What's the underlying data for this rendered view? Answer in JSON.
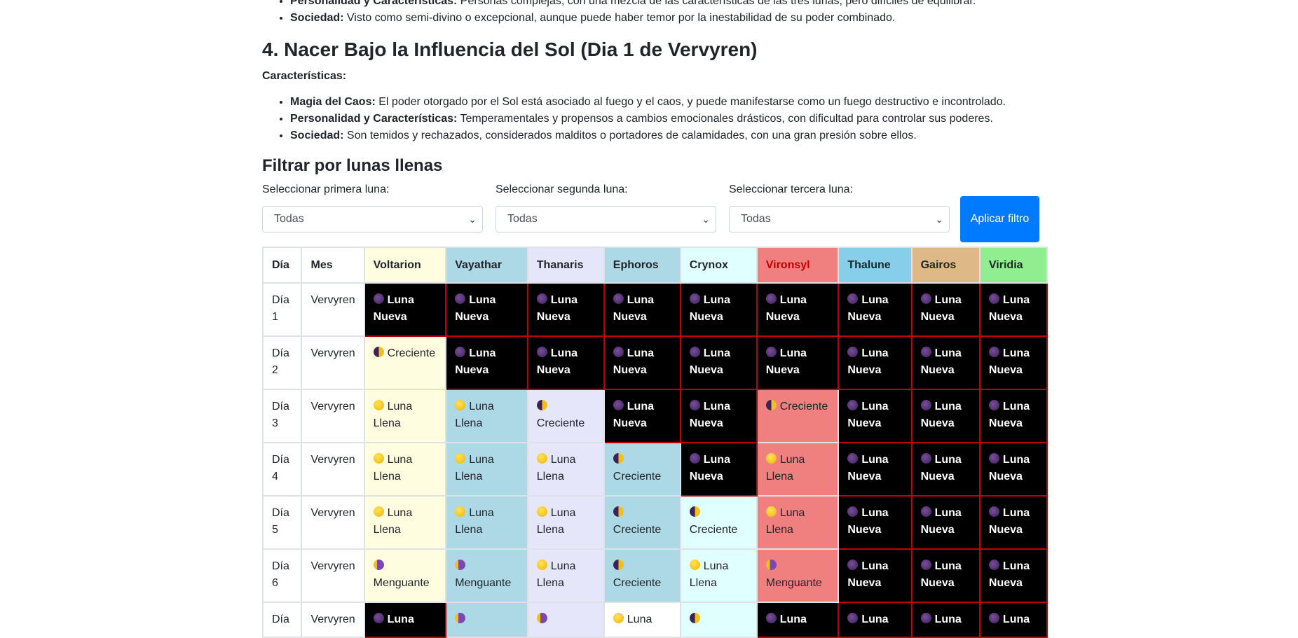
{
  "top_items": [
    {
      "label": "Personalidad y Características:",
      "text": " Personas complejas, con una mezcla de las características de las tres lunas, pero difíciles de equilibrar."
    },
    {
      "label": "Sociedad:",
      "text": " Visto como semi-divino o excepcional, aunque puede haber temor por la inestabilidad de su poder combinado."
    }
  ],
  "section": {
    "title": "4. Nacer Bajo la Influencia del Sol (Dia 1 de Vervyren)",
    "caracteristicas": "Características:",
    "items": [
      {
        "label": "Magia del Caos:",
        "text": " El poder otorgado por el Sol está asociado al fuego y el caos, y puede manifestarse como un fuego destructivo e incontrolado."
      },
      {
        "label": "Personalidad y Características:",
        "text": " Temperamentales y propensos a cambios emocionales drásticos, con dificultad para controlar sus poderes."
      },
      {
        "label": "Sociedad:",
        "text": " Son temidos y rechazados, considerados malditos o portadores de calamidades, con una gran presión sobre ellos."
      }
    ]
  },
  "filter": {
    "title": "Filtrar por lunas llenas",
    "first_label": "Seleccionar primera luna:",
    "second_label": "Seleccionar segunda luna:",
    "third_label": "Seleccionar tercera luna:",
    "first_value": "Todas",
    "second_value": "Todas",
    "third_value": "Todas",
    "apply_label": "Aplicar filtro"
  },
  "table": {
    "headers": [
      "Día",
      "Mes",
      "Voltarion",
      "Vayathar",
      "Thanaris",
      "Ephoros",
      "Crynox",
      "Vironsyl",
      "Thalune",
      "Gairos",
      "Viridia"
    ],
    "header_colors": [
      "#ffffff",
      "#ffffff",
      "#fffde0",
      "#add8e6",
      "#e6e6fa",
      "#add8e6",
      "#e0ffff",
      "#f08080",
      "#87ceeb",
      "#deb887",
      "#90ee90"
    ],
    "rows": [
      {
        "day": "Día 1",
        "month": "Vervyren",
        "cells": [
          "Luna Nueva",
          "Luna Nueva",
          "Luna Nueva",
          "Luna Nueva",
          "Luna Nueva",
          "Luna Nueva",
          "Luna Nueva",
          "Luna Nueva",
          "Luna Nueva"
        ]
      },
      {
        "day": "Día 2",
        "month": "Vervyren",
        "cells": [
          "Creciente",
          "Luna Nueva",
          "Luna Nueva",
          "Luna Nueva",
          "Luna Nueva",
          "Luna Nueva",
          "Luna Nueva",
          "Luna Nueva",
          "Luna Nueva"
        ]
      },
      {
        "day": "Día 3",
        "month": "Vervyren",
        "cells": [
          "Luna Llena",
          "Luna Llena",
          "Creciente",
          "Luna Nueva",
          "Luna Nueva",
          "Creciente",
          "Luna Nueva",
          "Luna Nueva",
          "Luna Nueva"
        ]
      },
      {
        "day": "Día 4",
        "month": "Vervyren",
        "cells": [
          "Luna Llena",
          "Luna Llena",
          "Luna Llena",
          "Creciente",
          "Luna Nueva",
          "Luna Llena",
          "Luna Nueva",
          "Luna Nueva",
          "Luna Nueva"
        ]
      },
      {
        "day": "Día 5",
        "month": "Vervyren",
        "cells": [
          "Luna Llena",
          "Luna Llena",
          "Luna Llena",
          "Creciente",
          "Creciente",
          "Luna Llena",
          "Luna Nueva",
          "Luna Nueva",
          "Luna Nueva"
        ]
      },
      {
        "day": "Día 6",
        "month": "Vervyren",
        "cells": [
          "Menguante",
          "Menguante",
          "Luna Llena",
          "Creciente",
          "Luna Llena",
          "Menguante",
          "Luna Nueva",
          "Luna Nueva",
          "Luna Nueva"
        ]
      },
      {
        "day": "Día",
        "month": "Vervyren",
        "cells": [
          "Luna",
          "",
          "",
          "Luna",
          "",
          "Luna",
          "Luna",
          "Luna",
          "Luna"
        ],
        "partial_icons": [
          "new",
          "meng",
          "meng",
          "full",
          "crec",
          "new",
          "new",
          "new",
          "new"
        ]
      }
    ]
  }
}
